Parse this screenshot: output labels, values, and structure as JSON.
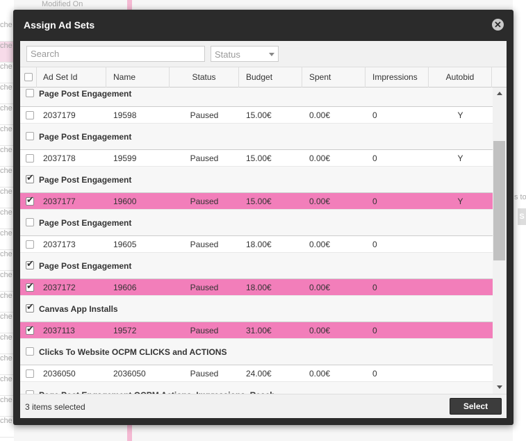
{
  "background": {
    "modified_on_label": "Modified On",
    "left_row_text": "che",
    "right_fragment_text": "s to",
    "right_button_text": "S"
  },
  "modal": {
    "title": "Assign Ad Sets",
    "close_icon": "close-icon"
  },
  "filters": {
    "search_placeholder": "Search",
    "search_value": "",
    "status_placeholder": "Status"
  },
  "columns": [
    "Ad Set Id",
    "Name",
    "Status",
    "Budget",
    "Spent",
    "Impressions",
    "Autobid"
  ],
  "groups": [
    {
      "label": "Page Post Engagement",
      "checked": false,
      "partial": true,
      "row": {
        "id": "2037179",
        "name": "19598",
        "status": "Paused",
        "budget": "15.00€",
        "spent": "0.00€",
        "impressions": "0",
        "autobid": "Y",
        "checked": false
      }
    },
    {
      "label": "Page Post Engagement",
      "checked": false,
      "row": {
        "id": "2037178",
        "name": "19599",
        "status": "Paused",
        "budget": "15.00€",
        "spent": "0.00€",
        "impressions": "0",
        "autobid": "Y",
        "checked": false
      }
    },
    {
      "label": "Page Post Engagement",
      "checked": true,
      "row": {
        "id": "2037177",
        "name": "19600",
        "status": "Paused",
        "budget": "15.00€",
        "spent": "0.00€",
        "impressions": "0",
        "autobid": "Y",
        "checked": true
      }
    },
    {
      "label": "Page Post Engagement",
      "checked": false,
      "row": {
        "id": "2037173",
        "name": "19605",
        "status": "Paused",
        "budget": "18.00€",
        "spent": "0.00€",
        "impressions": "0",
        "autobid": "",
        "checked": false
      }
    },
    {
      "label": "Page Post Engagement",
      "checked": true,
      "row": {
        "id": "2037172",
        "name": "19606",
        "status": "Paused",
        "budget": "18.00€",
        "spent": "0.00€",
        "impressions": "0",
        "autobid": "",
        "checked": true
      }
    },
    {
      "label": "Canvas App Installs",
      "checked": true,
      "row": {
        "id": "2037113",
        "name": "19572",
        "status": "Paused",
        "budget": "31.00€",
        "spent": "0.00€",
        "impressions": "0",
        "autobid": "",
        "checked": true
      }
    },
    {
      "label": "Clicks To Website OCPM CLICKS and ACTIONS",
      "checked": false,
      "row": {
        "id": "2036050",
        "name": "2036050",
        "status": "Paused",
        "budget": "24.00€",
        "spent": "0.00€",
        "impressions": "0",
        "autobid": "",
        "checked": false
      }
    },
    {
      "label": "Page Post Engagement OCPM Actions, Impressions, Reach",
      "checked": false,
      "partial": true
    }
  ],
  "footer": {
    "selected_text": "3 items selected",
    "select_button": "Select"
  },
  "colors": {
    "selected_row": "#f27eba",
    "modal_bg": "#2b2b2b"
  }
}
